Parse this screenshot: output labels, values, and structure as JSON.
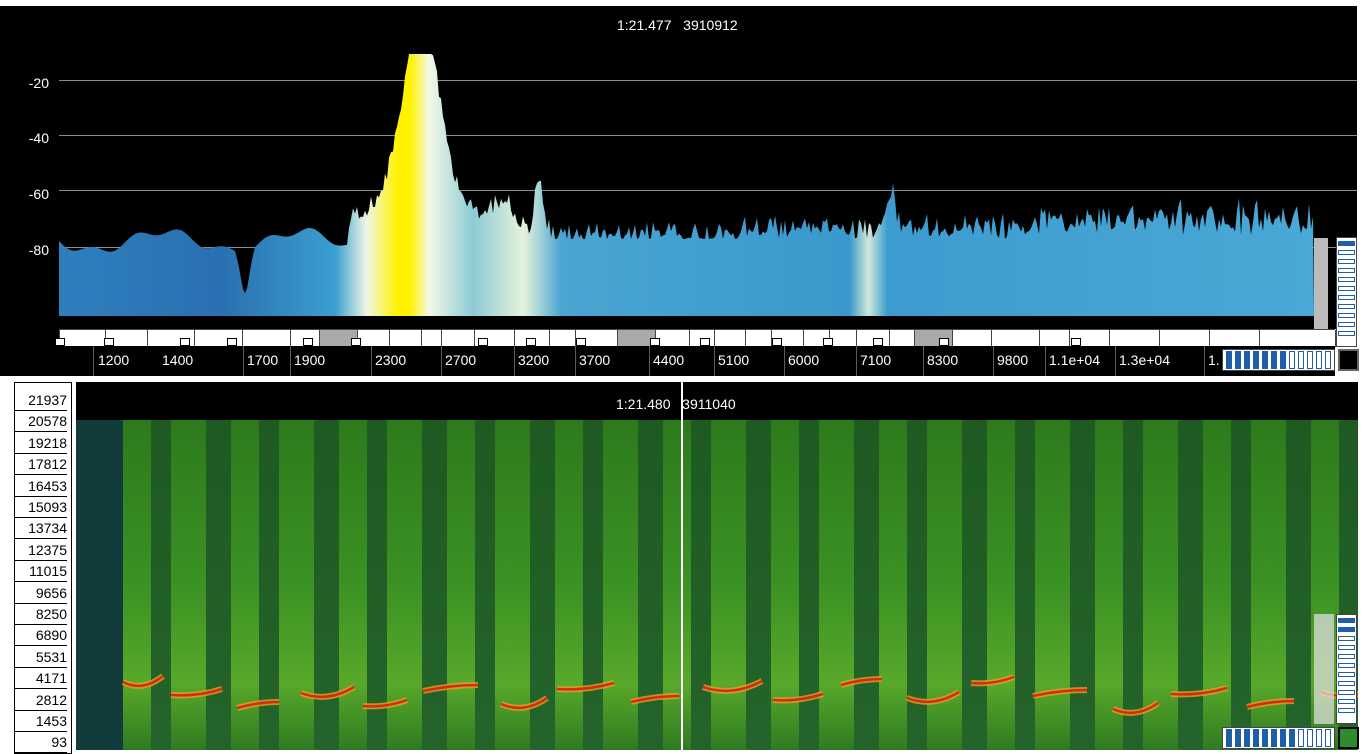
{
  "spectrum": {
    "timestamp": "1:21.477",
    "sample": "3910912",
    "db_labels": [
      "-20",
      "-40",
      "-60",
      "-80"
    ],
    "freq_labels": [
      "1200",
      "1400",
      "1700",
      "1900",
      "2300",
      "2700",
      "3200",
      "3700",
      "4400",
      "5100",
      "6000",
      "7100",
      "8300",
      "9800",
      "1.1e+04",
      "1.3e+04",
      "1."
    ]
  },
  "spectrogram": {
    "timestamp": "1:21.480",
    "sample": "3911040",
    "hz_labels": [
      "21937",
      "20578",
      "19218",
      "17812",
      "16453",
      "15093",
      "13734",
      "12375",
      "11015",
      "9656",
      "8250",
      "6890",
      "5531",
      "4171",
      "2812",
      "1453",
      "93"
    ]
  },
  "colors": {
    "spectrum_blue": "#2f8fc8",
    "peak_yellow": "#fff200",
    "spectrogram_green": "#3a8a1a",
    "trace_red": "#d82a10",
    "scroll_slot_blue": "#1f5fa8",
    "indicator_green": "#2e8b2e"
  }
}
